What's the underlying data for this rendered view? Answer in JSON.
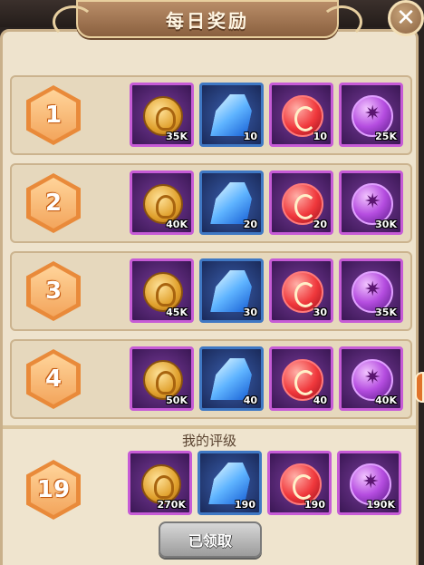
{
  "title": "每日奖励",
  "close_glyph": "✕",
  "rows": [
    {
      "level": "1",
      "rewards": [
        "35K",
        "10",
        "10",
        "25K"
      ]
    },
    {
      "level": "2",
      "rewards": [
        "40K",
        "20",
        "20",
        "30K"
      ]
    },
    {
      "level": "3",
      "rewards": [
        "45K",
        "30",
        "30",
        "35K"
      ]
    },
    {
      "level": "4",
      "rewards": [
        "50K",
        "40",
        "40",
        "40K"
      ]
    }
  ],
  "reward_icons": [
    "gold-coin-icon",
    "blue-crystal-icon",
    "red-orb-icon",
    "purple-orb-icon"
  ],
  "my_rating": {
    "label": "我的评级",
    "level": "19",
    "rewards": [
      "270K",
      "190",
      "190",
      "190K"
    ]
  },
  "claim_button": "已领取",
  "colors": {
    "accent_orange": "#e98a3a",
    "item_purple": "#c65bd6",
    "item_blue": "#3f78c4",
    "panel_bg": "#eee3cd"
  }
}
